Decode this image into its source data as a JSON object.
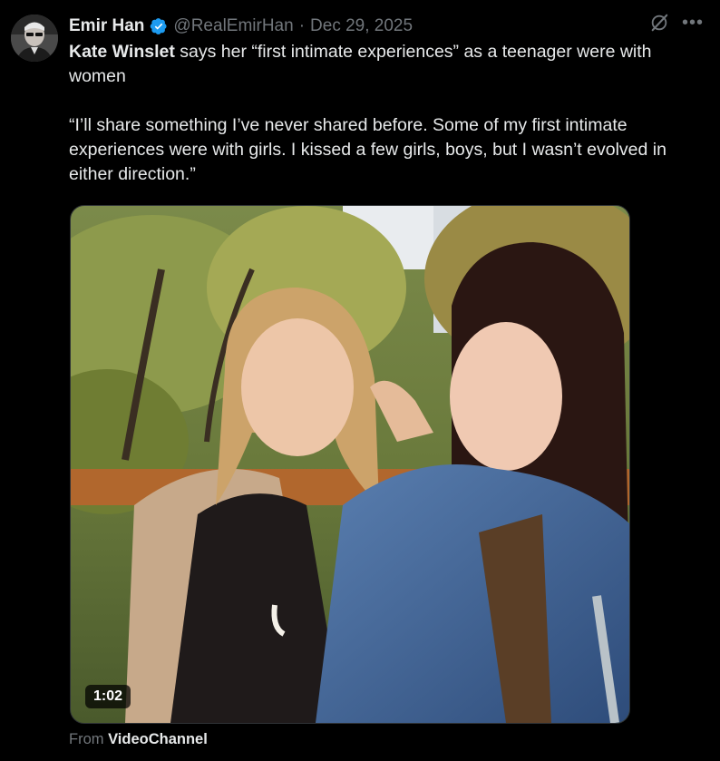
{
  "tweet": {
    "author": {
      "display_name": "Emir Han",
      "handle": "@RealEmirHan",
      "verified": true,
      "avatar": "avatar-photo"
    },
    "separator": "·",
    "date": "Dec 29, 2025",
    "text": {
      "bold_lead": "Kate Winslet",
      "line1_rest": " says her “first intimate experiences” as a teenager were with women",
      "quote": "“I’ll share something I’ve never shared before. Some of my first intimate experiences were with girls. I kissed a few girls, boys, but I wasn’t evolved in either direction.”"
    },
    "media": {
      "type": "video",
      "duration": "1:02"
    },
    "source": {
      "prefix": "From ",
      "name": "VideoChannel"
    },
    "icons": {
      "verified": "verified-badge-icon",
      "grok": "grok-icon",
      "more": "more-options-icon"
    },
    "colors": {
      "background": "#000000",
      "text": "#e7e9ea",
      "secondary": "#71767b",
      "verified_blue": "#1d9bf0"
    }
  }
}
